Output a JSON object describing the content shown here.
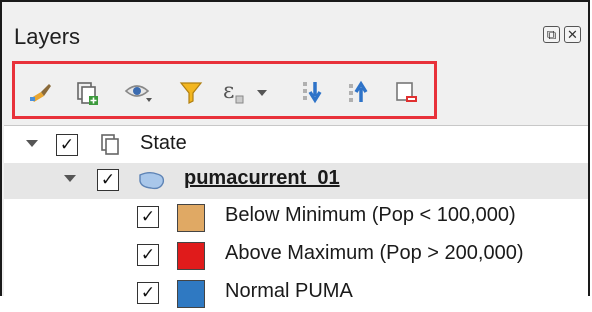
{
  "panel": {
    "title": "Layers",
    "float_glyph": "⧉",
    "close_glyph": "✕"
  },
  "toolbar": {
    "items": [
      {
        "name": "style-manager-icon"
      },
      {
        "name": "add-group-icon"
      },
      {
        "name": "manage-visibility-icon"
      },
      {
        "name": "filter-legend-icon"
      },
      {
        "name": "filter-expression-icon",
        "text": "ε"
      },
      {
        "name": "expand-all-icon"
      },
      {
        "name": "collapse-all-icon"
      },
      {
        "name": "remove-layer-icon"
      }
    ]
  },
  "tree": {
    "check_glyph": "✓",
    "group": {
      "label": "State"
    },
    "layer": {
      "label": "pumacurrent_01"
    },
    "legend": [
      {
        "label": "Below Minimum  (Pop < 100,000)",
        "color": "#e0a964"
      },
      {
        "label": "Above Maximum (Pop > 200,000)",
        "color": "#e01b1b"
      },
      {
        "label": "Normal PUMA",
        "color": "#2f79c2"
      }
    ]
  }
}
